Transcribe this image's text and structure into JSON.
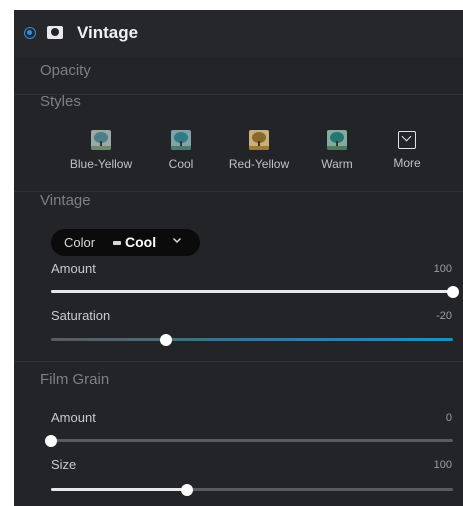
{
  "header": {
    "title": "Vintage",
    "enabled": true,
    "accent": "#2c8fe6",
    "icon": "layer-mask-icon"
  },
  "opacity": {
    "label": "Opacity"
  },
  "styles": {
    "label": "Styles",
    "items": [
      {
        "label": "Blue-Yellow",
        "icon": "tree-thumbnail-icon",
        "tint": "#5f8f98"
      },
      {
        "label": "Cool",
        "icon": "tree-thumbnail-icon",
        "tint": "#3f8c96"
      },
      {
        "label": "Red-Yellow",
        "icon": "tree-thumbnail-icon",
        "tint": "#b0883c"
      },
      {
        "label": "Warm",
        "icon": "tree-thumbnail-icon",
        "tint": "#2f8a84"
      },
      {
        "label": "More",
        "icon": "chevron-down-box-icon"
      }
    ]
  },
  "vintage": {
    "label": "Vintage",
    "color": {
      "label": "Color",
      "value": "Cool"
    },
    "amount": {
      "label": "Amount",
      "value": "100",
      "fraction": 1.0
    },
    "saturation": {
      "label": "Saturation",
      "value": "-20",
      "fraction": 0.286,
      "fill_color": "#1b8fc7"
    }
  },
  "film_grain": {
    "label": "Film Grain",
    "amount": {
      "label": "Amount",
      "value": "0",
      "fraction": 0.0
    },
    "size": {
      "label": "Size",
      "value": "100",
      "fraction": 0.339
    }
  },
  "colors": {
    "panel_bg": "#232428",
    "track": "#5a5b60",
    "track_fill": "#e8e8ea"
  }
}
